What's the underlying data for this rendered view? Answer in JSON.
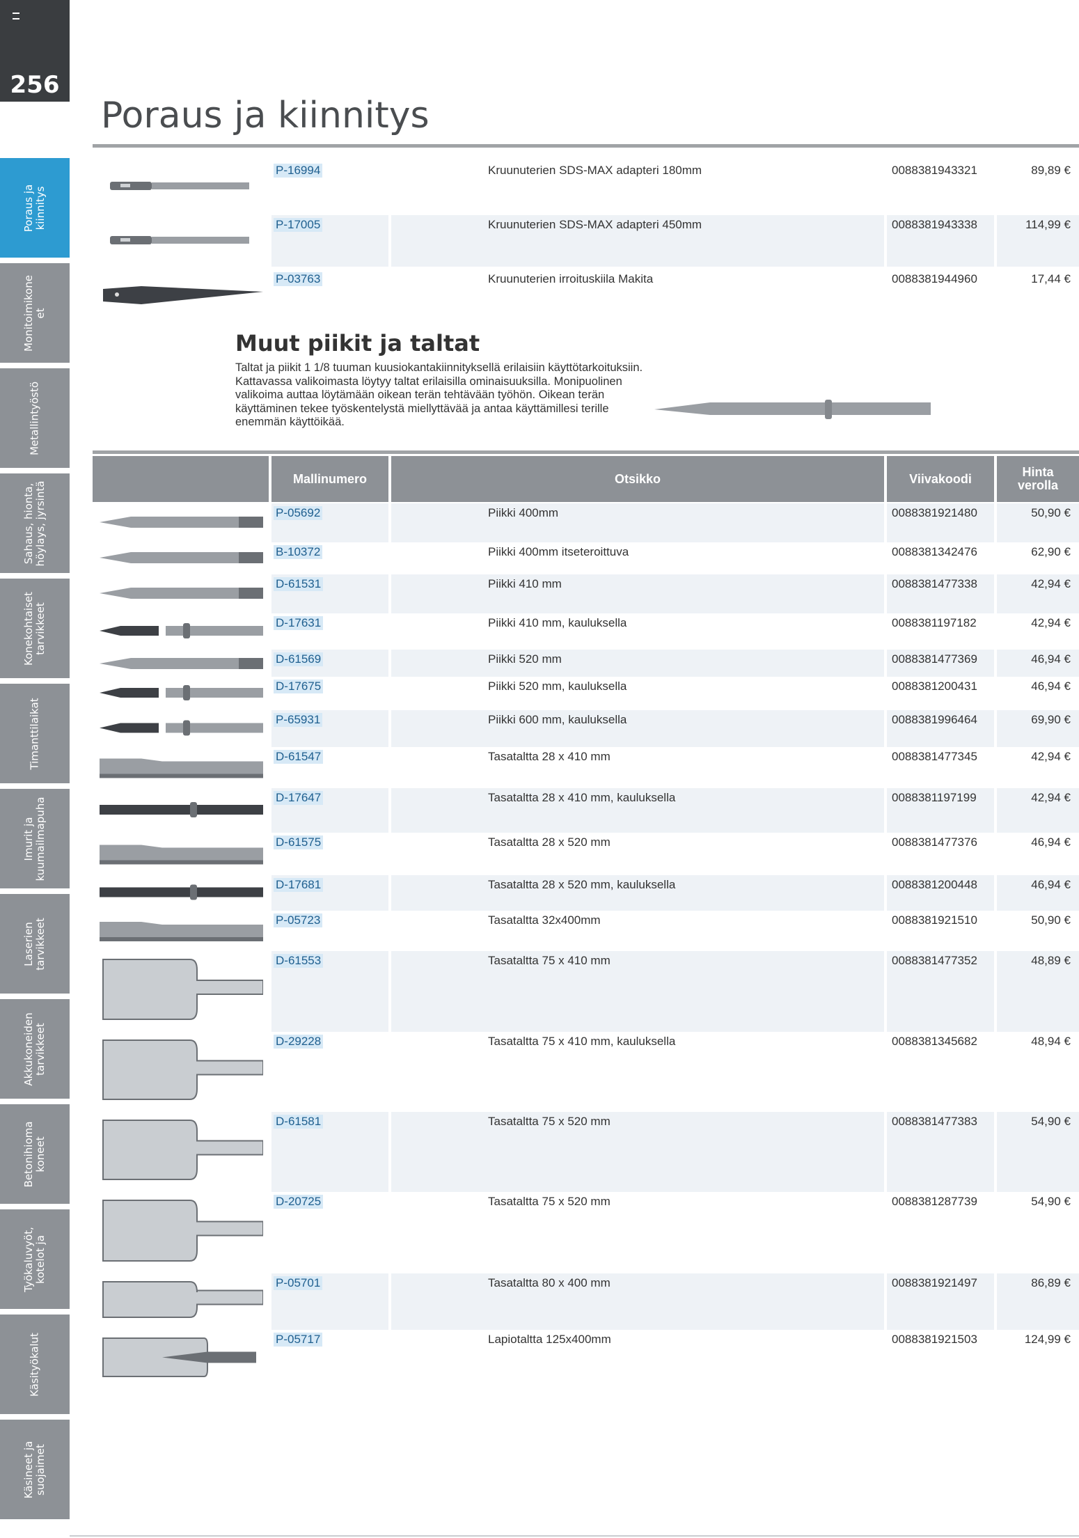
{
  "page": {
    "number": "256",
    "title": "Poraus ja kiinnitys"
  },
  "sidebar": {
    "items": [
      {
        "label": "Poraus ja\nkiinnitys",
        "active": true
      },
      {
        "label": "Monitoimikone\net",
        "active": false
      },
      {
        "label": "Metallintyöstö",
        "active": false
      },
      {
        "label": "Sahaus, hionta,\nhöylays, jyrsintä",
        "active": false
      },
      {
        "label": "Konekohtaiset\ntarvikkeet",
        "active": false
      },
      {
        "label": "Timanttilaikat",
        "active": false
      },
      {
        "label": "Imurit ja\nkuumailmapuha",
        "active": false
      },
      {
        "label": "Laserien\ntarvikkeet",
        "active": false
      },
      {
        "label": "Akkukoneiden\ntarvikkeet",
        "active": false
      },
      {
        "label": "Betonihioma\nkoneet",
        "active": false
      },
      {
        "label": "Työkaluvyöt,\nkotelot ja",
        "active": false
      },
      {
        "label": "Käsityökalut",
        "active": false
      },
      {
        "label": "Käsineet ja\nsuojaimet",
        "active": false
      }
    ]
  },
  "top_products": [
    {
      "model": "P-16994",
      "title": "Kruunuterien SDS-MAX adapteri 180mm",
      "barcode": "0088381943321",
      "price": "89,89 €",
      "icon": "adapter-icon"
    },
    {
      "model": "P-17005",
      "title": "Kruunuterien SDS-MAX adapteri 450mm",
      "barcode": "0088381943338",
      "price": "114,99 €",
      "icon": "adapter-icon"
    },
    {
      "model": "P-03763",
      "title": "Kruunuterien irroituskiila Makita",
      "barcode": "0088381944960",
      "price": "17,44 €",
      "icon": "wedge-icon"
    }
  ],
  "section": {
    "title": "Muut piikit ja taltat",
    "text": "Taltat ja piikit 1 1/8 tuuman kuusiokantakiinnityksellä erilaisiin käyttötarkoituksiin. Kattavassa valikoimasta löytyy taltat erilaisilla ominaisuuksilla. Monipuolinen valikoima auttaa löytämään oikean terän tehtävään työhön. Oikean terän käyttäminen tekee työskentelystä miellyttävää ja antaa käyttämillesi terille enemmän käyttöikää."
  },
  "table": {
    "headers": {
      "model": "Mallinumero",
      "title": "Otsikko",
      "barcode": "Viivakoodi",
      "price": "Hinta\nverolla"
    },
    "rows": [
      {
        "model": "P-05692",
        "title": "Piikki 400mm",
        "barcode": "0088381921480",
        "price": "50,90 €",
        "icon": "point-chisel-icon"
      },
      {
        "model": "B-10372",
        "title": "Piikki 400mm itseteroittuva",
        "barcode": "0088381342476",
        "price": "62,90 €",
        "icon": "point-chisel-icon"
      },
      {
        "model": "D-61531",
        "title": "Piikki 410 mm",
        "barcode": "0088381477338",
        "price": "42,94 €",
        "icon": "point-chisel-icon"
      },
      {
        "model": "D-17631",
        "title": "Piikki 410 mm, kauluksella",
        "barcode": "0088381197182",
        "price": "42,94 €",
        "icon": "collar-point-chisel-icon"
      },
      {
        "model": "D-61569",
        "title": "Piikki 520 mm",
        "barcode": "0088381477369",
        "price": "46,94 €",
        "icon": "point-chisel-icon"
      },
      {
        "model": "D-17675",
        "title": "Piikki 520 mm, kauluksella",
        "barcode": "0088381200431",
        "price": "46,94 €",
        "icon": "collar-point-chisel-icon"
      },
      {
        "model": "P-65931",
        "title": "Piikki 600 mm, kauluksella",
        "barcode": "0088381996464",
        "price": "69,90 €",
        "icon": "collar-point-chisel-icon"
      },
      {
        "model": "D-61547",
        "title": "Tasataltta 28 x 410 mm",
        "barcode": "0088381477345",
        "price": "42,94 €",
        "icon": "flat-chisel-icon"
      },
      {
        "model": "D-17647",
        "title": "Tasataltta 28 x 410 mm, kauluksella",
        "barcode": "0088381197199",
        "price": "42,94 €",
        "icon": "collar-flat-chisel-icon"
      },
      {
        "model": "D-61575",
        "title": "Tasataltta 28 x 520 mm",
        "barcode": "0088381477376",
        "price": "46,94 €",
        "icon": "flat-chisel-icon"
      },
      {
        "model": "D-17681",
        "title": "Tasataltta 28 x 520 mm, kauluksella",
        "barcode": "0088381200448",
        "price": "46,94 €",
        "icon": "collar-flat-chisel-icon"
      },
      {
        "model": "P-05723",
        "title": "Tasataltta 32x400mm",
        "barcode": "0088381921510",
        "price": "50,90 €",
        "icon": "flat-chisel-icon"
      },
      {
        "model": "D-61553",
        "title": "Tasataltta 75 x 410 mm",
        "barcode": "0088381477352",
        "price": "48,89 €",
        "icon": "wide-chisel-icon"
      },
      {
        "model": "D-29228",
        "title": "Tasataltta 75 x 410 mm, kauluksella",
        "barcode": "0088381345682",
        "price": "48,94 €",
        "icon": "wide-chisel-icon"
      },
      {
        "model": "D-61581",
        "title": "Tasataltta 75 x 520 mm",
        "barcode": "0088381477383",
        "price": "54,90 €",
        "icon": "wide-chisel-icon"
      },
      {
        "model": "D-20725",
        "title": "Tasataltta 75 x 520 mm",
        "barcode": "0088381287739",
        "price": "54,90 €",
        "icon": "wide-chisel-icon"
      },
      {
        "model": "P-05701",
        "title": "Tasataltta 80 x 400 mm",
        "barcode": "0088381921497",
        "price": "86,89 €",
        "icon": "wide-chisel-icon"
      },
      {
        "model": "P-05717",
        "title": "Lapiotaltta 125x400mm",
        "barcode": "0088381921503",
        "price": "124,99 €",
        "icon": "spade-chisel-icon"
      }
    ]
  },
  "colors": {
    "active_tab": "#2d9bd1",
    "tab": "#8d9196",
    "header": "#8d9196",
    "row_shade": "#eef2f6",
    "model_chip": "#d7e9f6"
  }
}
